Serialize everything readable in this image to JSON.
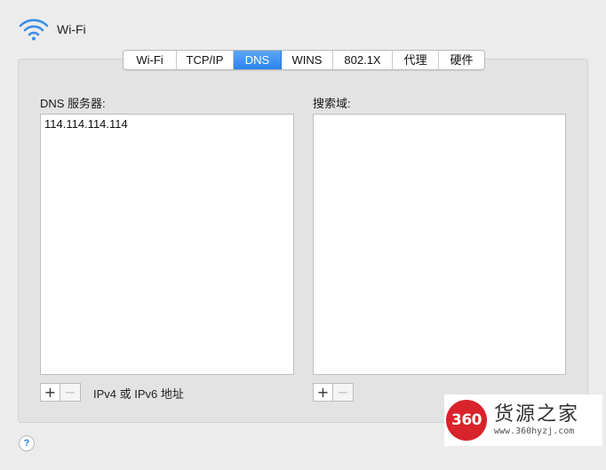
{
  "header": {
    "title": "Wi-Fi",
    "icon": "wifi-icon",
    "accent": "#2c83ee"
  },
  "tabs": [
    {
      "label": "Wi-Fi",
      "active": false
    },
    {
      "label": "TCP/IP",
      "active": false
    },
    {
      "label": "DNS",
      "active": true
    },
    {
      "label": "WINS",
      "active": false
    },
    {
      "label": "802.1X",
      "active": false
    },
    {
      "label": "代理",
      "active": false
    },
    {
      "label": "硬件",
      "active": false
    }
  ],
  "dns": {
    "label": "DNS 服务器:",
    "servers": [
      "114.114.114.114"
    ],
    "add_button": "+",
    "remove_button": "−",
    "hint": "IPv4 或 IPv6 地址"
  },
  "search": {
    "label": "搜索域:",
    "domains": [],
    "add_button": "+",
    "remove_button": "−"
  },
  "help": {
    "label": "?"
  },
  "watermark": {
    "logo_text": "360",
    "name": "货源之家",
    "url": "www.360hyzj.com",
    "logo_color": "#d8232a"
  }
}
